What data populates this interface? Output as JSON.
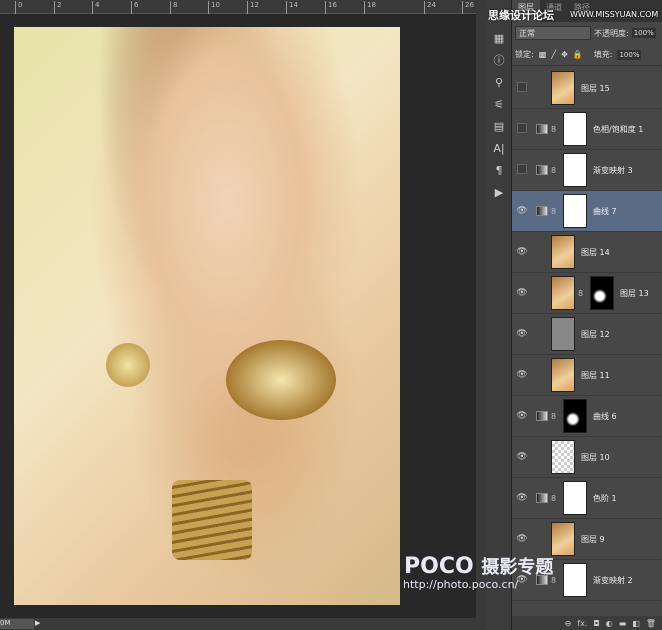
{
  "ruler": {
    "ticks": [
      "0",
      "2",
      "4",
      "6",
      "8",
      "10",
      "12",
      "14",
      "16",
      "18",
      "24",
      "26"
    ]
  },
  "status": {
    "zoom": "0M",
    "arrow": "▶"
  },
  "panel": {
    "tabs": [
      "图层",
      "通道",
      "路径"
    ],
    "blend_mode": "正常",
    "opacity_label": "不透明度:",
    "opacity": "100%",
    "lock_label": "锁定:",
    "fill_label": "填充:",
    "fill": "100%",
    "layers": [
      {
        "name": "图层 15",
        "visible": false,
        "thumb": "photo"
      },
      {
        "name": "色相/饱和度 1",
        "visible": false,
        "adj": true,
        "mask": "white"
      },
      {
        "name": "渐变映射 3",
        "visible": false,
        "adj": true,
        "mask": "white"
      },
      {
        "name": "曲线 7",
        "visible": true,
        "adj": true,
        "mask": "white",
        "selected": true
      },
      {
        "name": "图层 14",
        "visible": true,
        "thumb": "photo"
      },
      {
        "name": "图层 13",
        "visible": true,
        "thumb": "photo",
        "mask": "black"
      },
      {
        "name": "图层 12",
        "visible": true,
        "thumb": "gray"
      },
      {
        "name": "图层 11",
        "visible": true,
        "thumb": "photo"
      },
      {
        "name": "曲线 6",
        "visible": true,
        "adj": true,
        "mask": "black"
      },
      {
        "name": "图层 10",
        "visible": true,
        "thumb": "trans"
      },
      {
        "name": "色阶 1",
        "visible": true,
        "adj": true,
        "mask": "white"
      },
      {
        "name": "图层 9",
        "visible": true,
        "thumb": "photo"
      },
      {
        "name": "渐变映射 2",
        "visible": true,
        "adj": true,
        "mask": "white"
      }
    ],
    "bottom_icons": [
      "⊖",
      "fx.",
      "◘",
      "◐",
      "▬",
      "◧",
      "🗑"
    ]
  },
  "watermark": {
    "site_cn": "思缘设计论坛",
    "site_url": "WWW.MISSYUAN.COM",
    "poco": "POCO",
    "poco_cn": "摄影专题",
    "poco_url": "http://photo.poco.cn/"
  }
}
